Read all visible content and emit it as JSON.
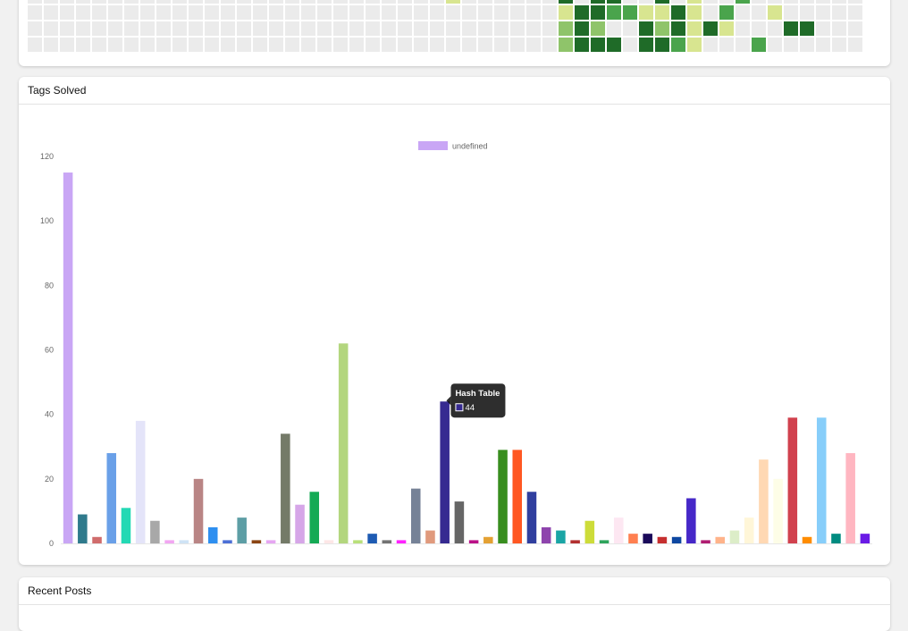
{
  "heatmap": {
    "colors": [
      "#ebebeb",
      "#d8e590",
      "#8fc46a",
      "#4aa44c",
      "#1f6b28"
    ],
    "rows": [
      "000000000000000000000000000000000000000000000000000000000000000000",
      "00000000000000000000000000000000000000000000000000000000000000000",
      "0000000000000000000000000000000000000000000000000000000000000000",
      "000000000000000000000000000000000000000000000000000000000000000000000000000000000000000000000000000000000000000000000000000000000000000000000",
      "00000000000000000000000000000000000000000000000000000000000000000",
      "000000000000000000000000000000000000000000000000000"
    ],
    "grid": [
      "00000000000000000000000000100000040440040100300000000004003",
      "00000000000000000000000000000000014433114103001000000000214",
      "00000000000000000000000000000000024200424141000440000000204",
      "00000000000000000000000000000000024440443100030000000000321"
    ]
  },
  "tags_card": {
    "title": "Tags Solved",
    "chart_data": {
      "type": "bar",
      "legend": {
        "label": "undefined",
        "color": "#c9a6f5",
        "position": "top-center"
      },
      "ylim": [
        0,
        120
      ],
      "yticks": [
        "0",
        "20",
        "40",
        "60",
        "80",
        "100",
        "120"
      ],
      "values": [
        115,
        9,
        2,
        28,
        11,
        38,
        7,
        1,
        1,
        20,
        5,
        1,
        8,
        1,
        1,
        34,
        12,
        16,
        1,
        62,
        1,
        3,
        1,
        1,
        17,
        4,
        44,
        13,
        1,
        2,
        29,
        29,
        16,
        5,
        4,
        1,
        7,
        1,
        8,
        3,
        3,
        2,
        2,
        14,
        1,
        2,
        4,
        8,
        26,
        20,
        39,
        2,
        39,
        3,
        28,
        3
      ],
      "colors": [
        "#c9a6f5",
        "#2f7a8c",
        "#d06c6c",
        "#6aa0e8",
        "#23d9b4",
        "#e4e4f9",
        "#a8a8a8",
        "#f2a6f2",
        "#cfe3f5",
        "#b98585",
        "#2e8ff0",
        "#4c6fd6",
        "#5d9ea5",
        "#8b4513",
        "#e6a6f2",
        "#747a68",
        "#d6a6e8",
        "#15aa55",
        "#fde7e7",
        "#b3d67e",
        "#b9e07a",
        "#1e5bb3",
        "#737373",
        "#ff22ff",
        "#768297",
        "#e09a7d",
        "#362a91",
        "#666666",
        "#bb1188",
        "#e4a133",
        "#388e1f",
        "#ff5722",
        "#303f9f",
        "#8e44ad",
        "#1aa5a5",
        "#b23030",
        "#cddc39",
        "#2ea45c",
        "#fde7f2",
        "#ff7f50",
        "#1a0a5a",
        "#c62f2f",
        "#0d47a1",
        "#4628c8",
        "#b01d72",
        "#ffb38a",
        "#dcedc8",
        "#fff6d8",
        "#ffd8b3",
        "#fdfde7",
        "#d1414e",
        "#ff8c00",
        "#87cefa",
        "#008b80",
        "#ffb6c1",
        "#6a1be6",
        "#c8843c"
      ],
      "tooltip": {
        "title": "Hash Table",
        "value": "44",
        "bar_index": 26
      }
    }
  },
  "posts_card": {
    "title": "Recent Posts"
  }
}
